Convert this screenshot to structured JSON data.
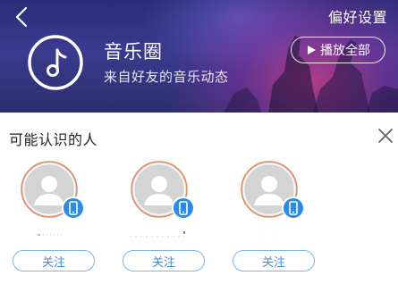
{
  "header": {
    "pref_label": "偏好设置",
    "title": "音乐圈",
    "subtitle": "来自好友的音乐动态",
    "play_all_label": "播放全部",
    "icons": {
      "back": "chevron-left-icon",
      "logo": "music-note-icon",
      "play": "play-icon"
    }
  },
  "panel": {
    "title": "可能认识的人",
    "close_icon": "close-icon",
    "people": [
      {
        "follow_label": "关注",
        "device_icon": "phone-icon"
      },
      {
        "follow_label": "关注",
        "device_icon": "phone-icon"
      },
      {
        "follow_label": "关注",
        "device_icon": "phone-icon"
      }
    ]
  },
  "colors": {
    "banner": "#2f3183",
    "accent_blue": "#3b8fdc",
    "badge_blue": "#2a8bea",
    "avatar_ring": "#e07a55"
  }
}
